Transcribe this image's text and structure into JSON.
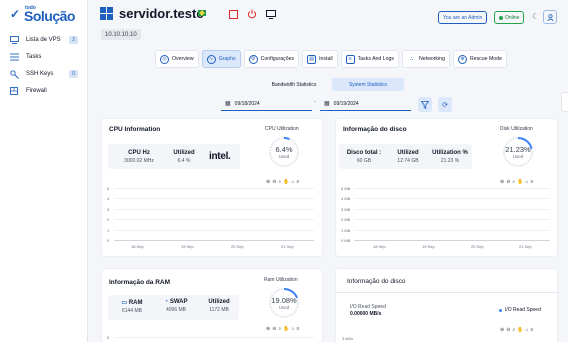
{
  "sidebar": {
    "logo_small": "todo",
    "logo_big": "Solução",
    "items": [
      {
        "label": "Lista de VPS",
        "count": "2",
        "icon": "monitor-icon"
      },
      {
        "label": "Tasks",
        "count": "",
        "icon": "list-icon"
      },
      {
        "label": "SSH Keys",
        "count": "0",
        "icon": "key-icon"
      },
      {
        "label": "Firewall",
        "count": "",
        "icon": "firewall-icon"
      }
    ]
  },
  "header": {
    "title": "servidor.teste",
    "admin_badge": "You are an Admin",
    "online_badge": "Online",
    "ip": "10.10.10.10"
  },
  "tabs": [
    {
      "label": "Overview",
      "active": false
    },
    {
      "label": "Graphs",
      "active": true
    },
    {
      "label": "Configurações",
      "active": false
    },
    {
      "label": "Install",
      "active": false
    },
    {
      "label": "Tasks And Logs",
      "active": false
    },
    {
      "label": "Networking",
      "active": false
    },
    {
      "label": "Rescue Mode",
      "active": false
    }
  ],
  "subtabs": [
    {
      "label": "Bandwidth Statistics",
      "active": false
    },
    {
      "label": "System Statistics",
      "active": true
    }
  ],
  "date_range": {
    "start": "09/18/2024",
    "end": "09/19/2024"
  },
  "cpu": {
    "title": "CPU Information",
    "hz_label": "CPU Hz",
    "hz_value": "3000.02 MHz",
    "used_label": "Utilized",
    "used_value": "6.4 %",
    "brand": "intel.",
    "gauge_label": "CPU Utilization",
    "gauge_value": "6.4%",
    "gauge_sub": "Used",
    "gauge_fraction": 0.064
  },
  "disk": {
    "title": "Informação do disco",
    "total_label": "Disco total :",
    "total_value": "60 GB",
    "used_label": "Utilized",
    "used_value": "12.74 GB",
    "pct_label": "Utilization %",
    "pct_value": "21.23 %",
    "gauge_label": "Disk Utilization",
    "gauge_value": "21.23%",
    "gauge_sub": "Used",
    "gauge_fraction": 0.2123
  },
  "ram": {
    "title": "Informação da RAM",
    "ram_label": "RAM",
    "ram_value": "6144 MB",
    "swap_label": "SWAP",
    "swap_value": "4096 MB",
    "used_label": "Utilized",
    "used_value": "1172 MB",
    "gauge_label": "Ram Utilization",
    "gauge_value": "19.08%",
    "gauge_sub": "Used",
    "gauge_fraction": 0.1908
  },
  "disk_io": {
    "title": "Informação do disco",
    "read_label": "I/O Read Speed",
    "read_value": "0.00000 MB/s",
    "legend": "I/O Read Speed",
    "axis_start": "3 kB/s"
  },
  "cpu_chart": {
    "y_ticks": [
      "5",
      "4",
      "3",
      "2",
      "1",
      "0"
    ],
    "x_ticks": [
      "18 Sep",
      "19 Sep",
      "20 Sep",
      "21 Sep"
    ]
  },
  "disk_chart": {
    "y_ticks": [
      "5 MB",
      "4 MB",
      "3 MB",
      "2 MB",
      "1 MB",
      "0 MB"
    ],
    "x_ticks": [
      "18 Sep",
      "19 Sep",
      "20 Sep",
      "21 Sep"
    ]
  },
  "ram_chart": {
    "y_start": "5"
  },
  "toolbar_icons": [
    "zoom-in-icon",
    "zoom-out-icon",
    "magnify-icon",
    "pan-icon",
    "home-icon",
    "menu-icon"
  ]
}
